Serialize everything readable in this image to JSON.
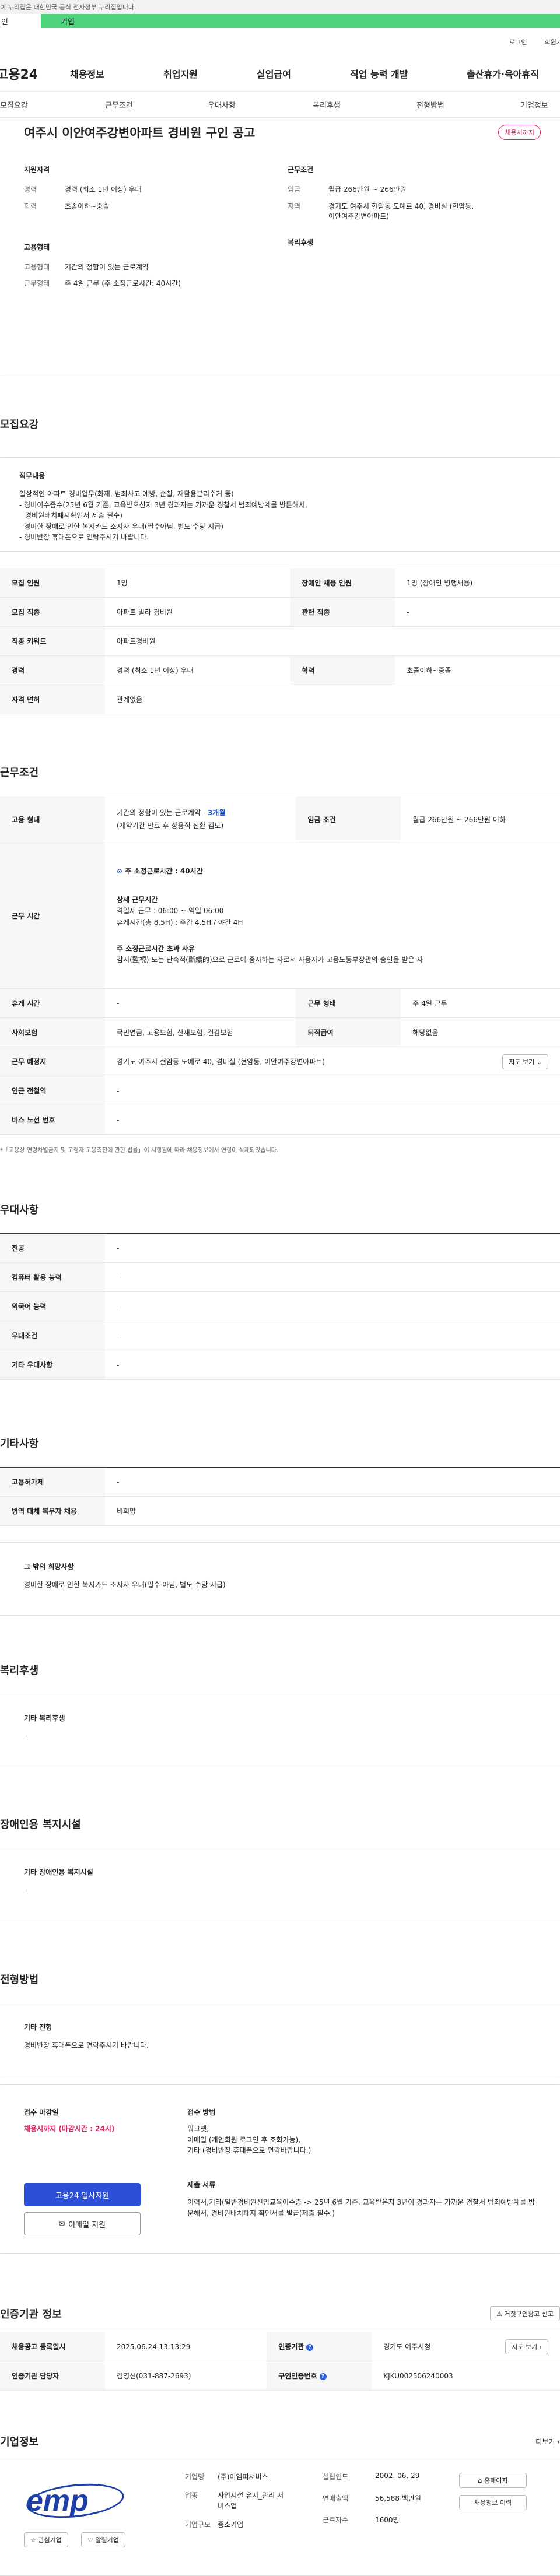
{
  "gov_banner": "이 누리집은 대한민국 공식 전자정부 누리집입니다.",
  "tabbar": {
    "left": "인",
    "right": "기업"
  },
  "util": {
    "login": "로그인",
    "join": "회원가입"
  },
  "gnb": {
    "logo": "고용24",
    "menu": [
      "채용정보",
      "취업지원",
      "실업급여",
      "직업 능력 개발",
      "출산휴가·육아휴직"
    ]
  },
  "tabs": [
    "모집요강",
    "근무조건",
    "우대사항",
    "복리후생",
    "전형방법",
    "기업정보"
  ],
  "summary": {
    "title": "여주시 이안여주강변아파트 경비원 구인 공고",
    "status": "채용시까지",
    "qual_title": "지원자격",
    "cond_title": "근무조건",
    "emp_title": "고용형태",
    "welfare_title": "복리후생",
    "career_k": "경력",
    "career_v": "경력 (최소 1년 이상) 우대",
    "edu_k": "학력",
    "edu_v": "초졸이하~중졸",
    "wage_k": "임금",
    "wage_v": "월급 266만원 ~ 266만원",
    "region_k": "지역",
    "region_v": "경기도 여주시 현암동 도예로 40, 경비실 (현암동, 이안여주강변아파트)",
    "emptype_k": "고용형태",
    "emptype_v": "기간의 정함이 있는 근로계약",
    "worktype_k": "근무형태",
    "worktype_v": "주 4일 근무 (주 소정근로시간: 40시간)"
  },
  "recruit": {
    "title": "모집요강",
    "duty_title": "직무내용",
    "duty_lines": [
      "일상적인 아파트 경비업무(화재, 범죄사고 예방, 순찰, 재활용분리수거 등)",
      "- 경비이수증수(25년 6월 기준, 교육받으신지 3년 경과자는 가까운 경찰서 범죄예방계를 방문해서,",
      "  경비원배치폐지확인서 제출 필수)",
      "- 경미한 장애로 인한 복지카드 소지자 우대(필수아님, 별도 수당 지급)",
      "- 경비반장 휴대폰으로 연락주시기 바랍니다."
    ],
    "rows": [
      {
        "k1": "모집 인원",
        "v1": "1명",
        "k2": "장애인 채용 인원",
        "v2": "1명 (장애인 병행채용)"
      },
      {
        "k1": "모집 직종",
        "v1": "아파트 빌라 경비원",
        "k2": "관련 직종",
        "v2": "-"
      },
      {
        "k1": "직종 키워드",
        "v1": "아파트경비원",
        "k2": "",
        "v2": ""
      },
      {
        "k1": "경력",
        "v1": "경력 (최소 1년 이상) 우대",
        "k2": "학력",
        "v2": "초졸이하~중졸"
      },
      {
        "k1": "자격 면허",
        "v1": "관계없음",
        "k2": "",
        "v2": ""
      }
    ]
  },
  "work": {
    "title": "근무조건",
    "emp_k": "고용 형태",
    "emp_v1": "기간의 정함이 있는 근로계약 - ",
    "emp_v1b": "3개월",
    "emp_v2": "(계약기간 만료 후 상용직 전환 검토)",
    "wage_k": "임금 조건",
    "wage_v": "월급 266만원 ~ 266만원 이하",
    "time_k": "근무 시간",
    "time_week": "주 소정근로시간 : 40시간",
    "time_detail_t": "상세 근무시간",
    "time_detail_1": "격일제 근무 : 06:00 ~ 익일 06:00",
    "time_detail_2": "휴게시간(총 8.5H) : 주간 4.5H / 야간 4H",
    "time_reason_t": "주 소정근로시간 초과 사유",
    "time_reason_v": "감시(監視) 또는 단속적(斷續的)으로 근로에 종사하는 자로서 사용자가 고용노동부장관의 승인을 받은 자",
    "rows": [
      {
        "k1": "휴게 시간",
        "v1": "-",
        "k2": "근무 형태",
        "v2": "주 4일 근무"
      },
      {
        "k1": "사회보험",
        "v1": "국민연금, 고용보험, 산재보험, 건강보험",
        "k2": "퇴직급여",
        "v2": "해당없음"
      }
    ],
    "place_k": "근무 예정지",
    "place_v": "경기도 여주시 현암동 도예로 40, 경비실 (현암동, 이안여주강변아파트)",
    "map_btn": "지도 보기 ⌄",
    "station_k": "인근 전철역",
    "station_v": "-",
    "bus_k": "버스 노선 번호",
    "bus_v": "-",
    "note": "*「고용상 연령차별금지 및 고령자 고용촉진에 관한 법률」이 시행됨에 따라 채용정보에서 연령이 삭제되었습니다."
  },
  "pref": {
    "title": "우대사항",
    "rows": [
      {
        "k": "전공",
        "v": "-"
      },
      {
        "k": "컴퓨터 활용 능력",
        "v": "-"
      },
      {
        "k": "외국어 능력",
        "v": "-"
      },
      {
        "k": "우대조건",
        "v": "-"
      },
      {
        "k": "기타 우대사항",
        "v": "-"
      }
    ]
  },
  "etc": {
    "title": "기타사항",
    "rows": [
      {
        "k": "고용허가제",
        "v": "-"
      },
      {
        "k": "병역 대체 복무자 채용",
        "v": "비희망"
      }
    ],
    "box_title": "그 밖의 희망사항",
    "box_text": "경미한 장애로 인한 복지카드 소지자 우대(필수 아님, 별도 수당 지급)"
  },
  "welfare": {
    "title": "복리후생",
    "box_title": "기타 복리후생",
    "box_text": "-"
  },
  "disab": {
    "title": "장애인용 복지시설",
    "box_title": "기타 장애인용 복지시설",
    "box_text": "-"
  },
  "select": {
    "title": "전형방법",
    "box_title": "기타 전형",
    "box_text": "경비반장 휴대폰으로 연락주시기 바랍니다.",
    "deadline_t": "접수 마감일",
    "deadline_v": "채용시까지 (마감시간 : 24시)",
    "apply_btn": "고용24 입사지원",
    "email_btn": "이메일 지원",
    "method_t": "접수 방법",
    "method_lines": [
      "워크넷,",
      "이메일 (개인회원 로그인 후 조회가능),",
      "기타 (경비반장 휴대폰으로 연락바랍니다.)"
    ],
    "docs_t": "제출 서류",
    "docs_v": "이력서,기타(일반경비원신임교육이수증 -> 25년 6월 기준, 교육받은지 3년이 경과자는 가까운 경찰서 범죄예방계를 방문해서,  경비원배치폐지 확인서를 발급(제출 필수.)"
  },
  "agency": {
    "title": "인증기관 정보",
    "report_btn": "거짓구인광고 신고",
    "reg_k": "채용공고 등록일시",
    "reg_v": "2025.06.24 13:13:29",
    "org_k": "인증기관",
    "org_v": "경기도 여주시청",
    "map_btn": "지도 보기 ›",
    "mgr_k": "인증기관 담당자",
    "mgr_v": "김영신(031-887-2693)",
    "no_k": "구인인증번호",
    "no_v": "KJKU002506240003"
  },
  "company": {
    "title": "기업정보",
    "more": "더보기 ›",
    "logo": "emp",
    "fav_btn": "관심기업",
    "follow_btn": "알림기업",
    "name_k": "기업명",
    "name_v": "(주)이엠피서비스",
    "ind_k": "업종",
    "ind_v": "사업시설 유지_관리 서비스업",
    "size_k": "기업규모",
    "size_v": "중소기업",
    "est_k": "설립연도",
    "est_v": "2002. 06. 29",
    "sales_k": "연매출액",
    "sales_v": "56,588 백만원",
    "emp_k": "근로자수",
    "emp_v": "1600명",
    "home_btn": "홈페이지",
    "list_btn": "채용정보 이력"
  }
}
